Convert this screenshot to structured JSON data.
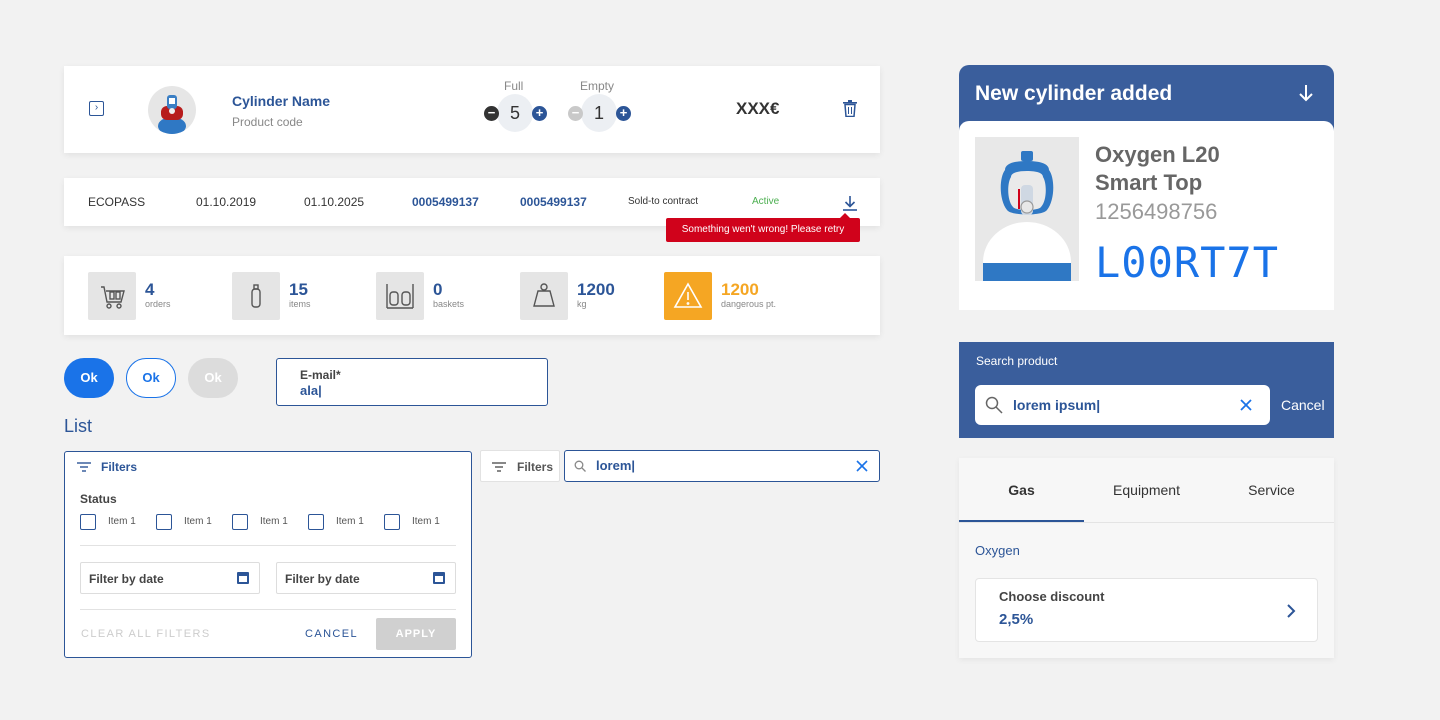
{
  "product": {
    "name": "Cylinder Name",
    "code": "Product code",
    "full_label": "Full",
    "full_value": "5",
    "empty_label": "Empty",
    "empty_value": "1",
    "price": "XXX€",
    "minus": "−",
    "plus": "+"
  },
  "contract": {
    "name": "ECOPASS",
    "start_date": "01.10.2019",
    "end_date": "01.10.2025",
    "number_1": "0005499137",
    "number_2": "0005499137",
    "type": "Sold-to contract",
    "status": "Active",
    "error_message": "Something wen't wrong! Please retry"
  },
  "stats": [
    {
      "value": "4",
      "label": "orders",
      "icon": "cart-icon"
    },
    {
      "value": "15",
      "label": "items",
      "icon": "bottle-icon"
    },
    {
      "value": "0",
      "label": "baskets",
      "icon": "basket-icon"
    },
    {
      "value": "1200",
      "label": "kg",
      "icon": "weight-icon"
    },
    {
      "value": "1200",
      "label": "dangerous pt.",
      "icon": "warning-icon"
    }
  ],
  "buttons": {
    "primary": "Ok",
    "secondary": "Ok",
    "disabled": "Ok"
  },
  "email_field": {
    "label": "E-mail*",
    "value": "ala|"
  },
  "list": {
    "title": "List",
    "filters_label": "Filters",
    "status_label": "Status",
    "items": [
      "Item 1",
      "Item 1",
      "Item 1",
      "Item 1",
      "Item 1"
    ],
    "date_filter_1": "Filter by date",
    "date_filter_2": "Filter by date",
    "clear_all": "CLEAR ALL FILTERS",
    "cancel": "CANCEL",
    "apply": "APPLY",
    "filters_button": "Filters",
    "search_value": "lorem|"
  },
  "new_cylinder": {
    "header": "New cylinder added",
    "name_line_1": "Oxygen L20",
    "name_line_2": "Smart Top",
    "code": "1256498756",
    "serial": "L00RT7T"
  },
  "search_product": {
    "label": "Search product",
    "value": "lorem ipsum|",
    "cancel": "Cancel"
  },
  "tabs": {
    "items": [
      "Gas",
      "Equipment",
      "Service"
    ],
    "active": "Gas",
    "section": "Oxygen",
    "discount_label": "Choose discount",
    "discount_value": "2,5%"
  },
  "colors": {
    "primary_navy": "#2c5597",
    "primary_blue": "#1a73e8",
    "header_blue": "#3a5e9c",
    "error_red": "#d0021b",
    "warning_orange": "#f5a623",
    "active_green": "#4caf50"
  }
}
